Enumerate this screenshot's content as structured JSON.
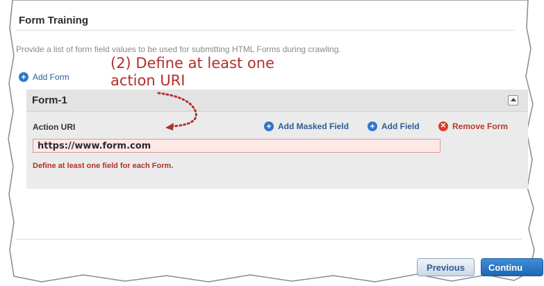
{
  "section": {
    "title": "Form Training",
    "description": "Provide a list of form field values to be used for submitting HTML Forms during crawling."
  },
  "add_form_label": "Add Form",
  "form": {
    "name": "Form-1",
    "action_uri_label": "Action URI",
    "action_uri_value": "https://www.form.com",
    "links": {
      "add_masked_field": "Add Masked Field",
      "add_field": "Add Field",
      "remove_form": "Remove Form"
    },
    "error": "Define at least one field for each Form."
  },
  "annotation": "(2) Define at least one\naction URI",
  "buttons": {
    "previous": "Previous",
    "continue": "Continu"
  },
  "icons": {
    "add": "plus-circle-icon",
    "remove": "x-circle-icon",
    "collapse": "collapse-up-icon"
  },
  "colors": {
    "link": "#2a5d9a",
    "error": "#b2302a",
    "annotation": "#b1302b",
    "primary_button": "#2066b1"
  }
}
